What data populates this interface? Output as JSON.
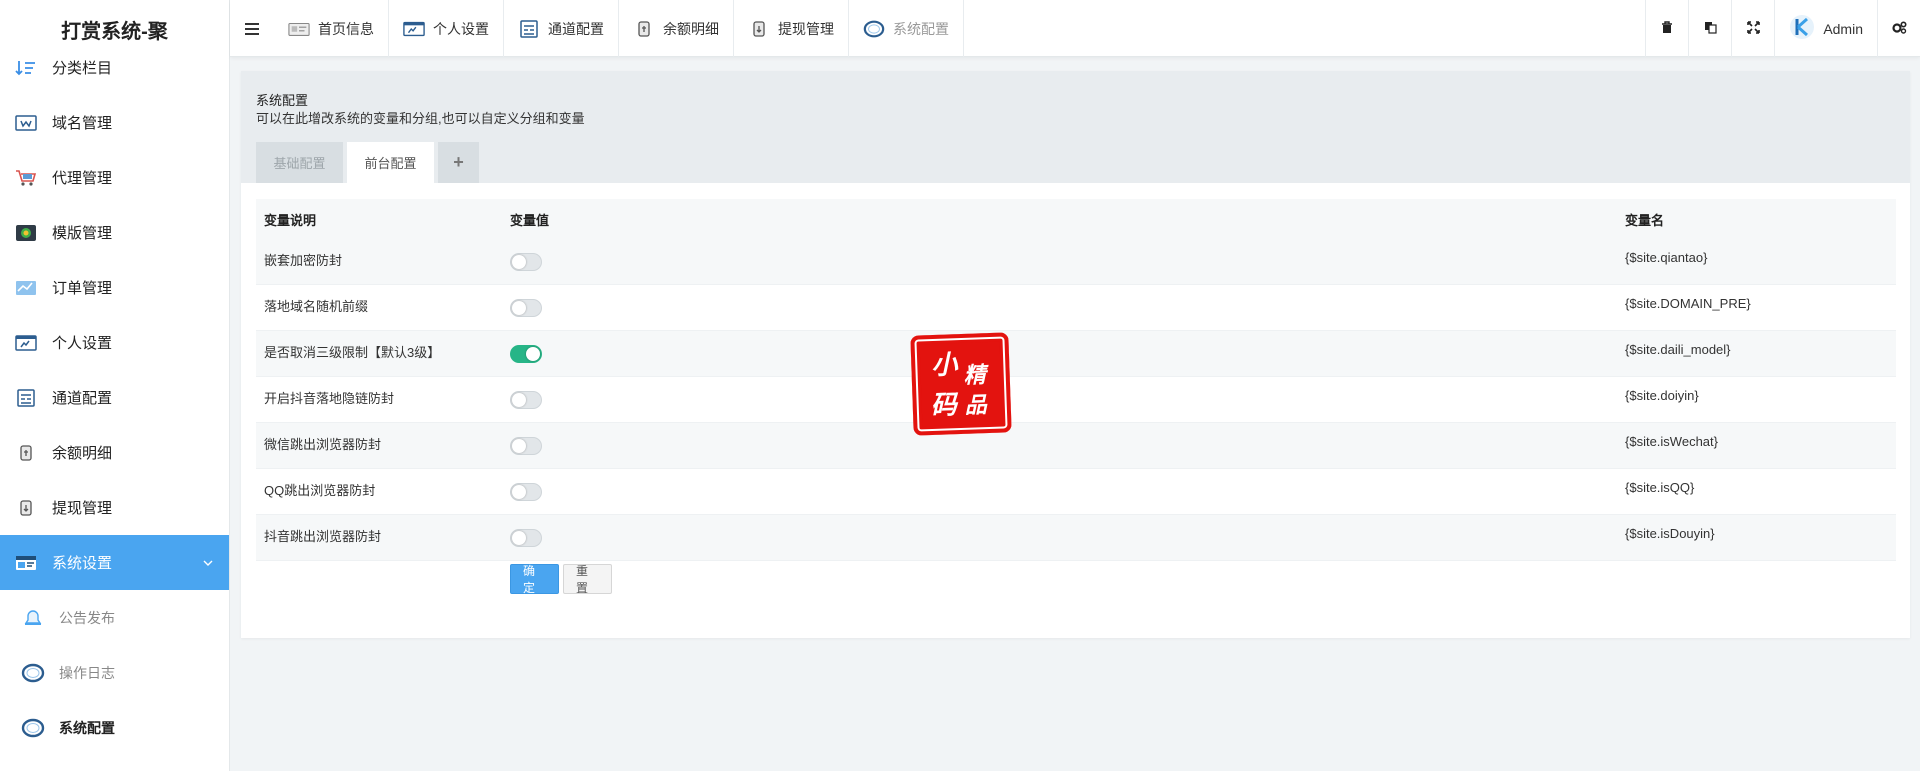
{
  "brand": {
    "title": "打赏系统-聚"
  },
  "sidebar": {
    "items": [
      {
        "label": "分类栏目",
        "icon": "sort-icon"
      },
      {
        "label": "域名管理",
        "icon": "domain-icon"
      },
      {
        "label": "代理管理",
        "icon": "cart-icon"
      },
      {
        "label": "模版管理",
        "icon": "template-icon"
      },
      {
        "label": "订单管理",
        "icon": "order-icon"
      },
      {
        "label": "个人设置",
        "icon": "profile-icon"
      },
      {
        "label": "通道配置",
        "icon": "channel-icon"
      },
      {
        "label": "余额明细",
        "icon": "wallet-icon"
      },
      {
        "label": "提现管理",
        "icon": "withdraw-icon"
      },
      {
        "label": "系统设置",
        "icon": "system-icon"
      }
    ],
    "subitems": [
      {
        "label": "公告发布",
        "icon": "bell-icon"
      },
      {
        "label": "操作日志",
        "icon": "circle-icon"
      },
      {
        "label": "系统配置",
        "icon": "circle-icon"
      }
    ]
  },
  "topbar": {
    "tabs": [
      {
        "label": "首页信息",
        "icon": "home-icon"
      },
      {
        "label": "个人设置",
        "icon": "profile-icon"
      },
      {
        "label": "通道配置",
        "icon": "channel-icon"
      },
      {
        "label": "余额明细",
        "icon": "wallet-icon"
      },
      {
        "label": "提现管理",
        "icon": "withdraw-icon"
      },
      {
        "label": "系统配置",
        "icon": "circle-icon"
      }
    ],
    "user": {
      "name": "Admin"
    }
  },
  "panel": {
    "title": "系统配置",
    "description": "可以在此增改系统的变量和分组,也可以自定义分组和变量",
    "tabs": [
      {
        "label": "基础配置",
        "active": false
      },
      {
        "label": "前台配置",
        "active": true
      },
      {
        "label": "+",
        "active": false
      }
    ]
  },
  "table": {
    "headers": [
      "变量说明",
      "变量值",
      "变量名"
    ],
    "rows": [
      {
        "desc": "嵌套加密防封",
        "enabled": false,
        "name": "{$site.qiantao}"
      },
      {
        "desc": "落地域名随机前缀",
        "enabled": false,
        "name": "{$site.DOMAIN_PRE}"
      },
      {
        "desc": "是否取消三级限制【默认3级】",
        "enabled": true,
        "name": "{$site.daili_model}"
      },
      {
        "desc": "开启抖音落地隐链防封",
        "enabled": false,
        "name": "{$site.doiyin}"
      },
      {
        "desc": "微信跳出浏览器防封",
        "enabled": false,
        "name": "{$site.isWechat}"
      },
      {
        "desc": "QQ跳出浏览器防封",
        "enabled": false,
        "name": "{$site.isQQ}"
      },
      {
        "desc": "抖音跳出浏览器防封",
        "enabled": false,
        "name": "{$site.isDouyin}"
      }
    ]
  },
  "buttons": {
    "submit": "确定",
    "reset": "重置"
  },
  "watermark": {
    "chars": [
      "小",
      "精",
      "码",
      "品"
    ]
  },
  "colors": {
    "accent": "#4aa5f0",
    "switch_on": "#27b587",
    "stamp": "#e3130f"
  }
}
